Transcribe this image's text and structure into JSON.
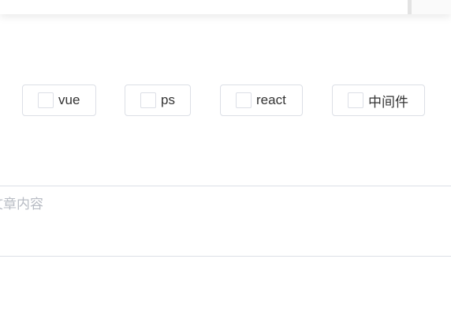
{
  "tags": {
    "items": [
      {
        "label": "vue",
        "checked": false
      },
      {
        "label": "ps",
        "checked": false
      },
      {
        "label": "react",
        "checked": false
      },
      {
        "label": "中间件",
        "checked": false
      }
    ]
  },
  "content": {
    "placeholder": "请输入文章内容",
    "visible_placeholder": "文章内容",
    "value": ""
  },
  "colors": {
    "border": "#dcdfe6",
    "placeholder": "#b8bcc4",
    "text": "#333333"
  }
}
